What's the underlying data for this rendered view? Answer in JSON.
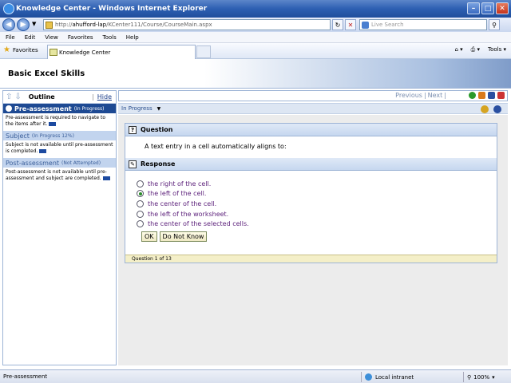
{
  "window": {
    "title": "Knowledge Center - Windows Internet Explorer",
    "min": "–",
    "max": "□",
    "close": "✕"
  },
  "address": {
    "prefix": "http://",
    "host": "ahufford-lap",
    "path": "/KCenter111/Course/CourseMain.aspx",
    "search_placeholder": "Live Search"
  },
  "menu": [
    "File",
    "Edit",
    "View",
    "Favorites",
    "Tools",
    "Help"
  ],
  "favorites": {
    "label": "Favorites",
    "tab": "Knowledge Center",
    "tools": "Tools"
  },
  "course": {
    "title": "Basic Excel Skills"
  },
  "outline": {
    "label": "Outline",
    "sep": "|",
    "hide": "Hide",
    "sections": [
      {
        "title": "Pre-assessment",
        "status": "(In Progress)",
        "note": "Pre-assessment is required to navigate to the items after it."
      },
      {
        "title": "Subject",
        "status": "(In Progress 12%)",
        "note": "Subject is not available until pre-assessment is completed."
      },
      {
        "title": "Post-assessment",
        "status": "(Not Attempted)",
        "note": "Post-assessment is not available until pre-assessment and subject are completed."
      }
    ]
  },
  "nav": {
    "previous": "Previous",
    "sep": "|",
    "next": "Next",
    "sep2": "|"
  },
  "status_row": {
    "label": "In Progress",
    "arrow": "▼"
  },
  "question": {
    "header": "Question",
    "text": "A text entry in a cell automatically aligns to:",
    "response_header": "Response",
    "answers": [
      "the right of the cell.",
      "the left of the cell.",
      "the center of the cell.",
      "the left of the worksheet.",
      "the center of the selected cells."
    ],
    "selected_index": 1,
    "ok": "OK",
    "dont_know": "Do Not Know",
    "progress": "Question 1 of 13"
  },
  "statusbar": {
    "left": "Pre-assessment",
    "zone": "Local intranet",
    "zoom": "100%"
  }
}
